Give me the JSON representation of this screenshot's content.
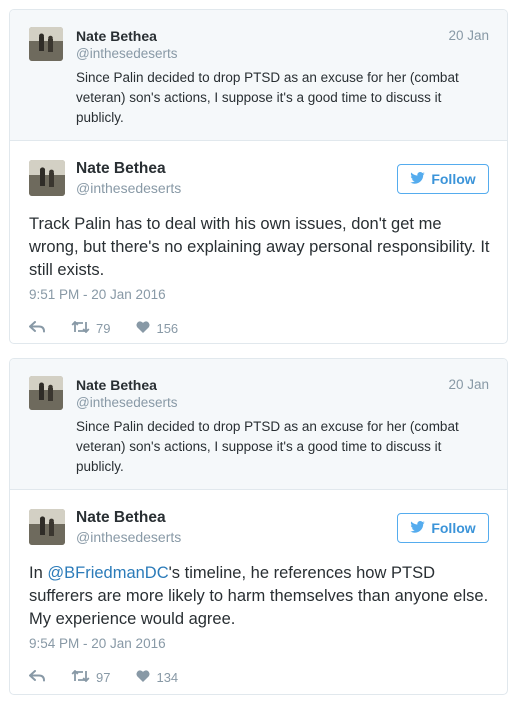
{
  "tweets": [
    {
      "quoted": {
        "name": "Nate Bethea",
        "handle": "@inthesedeserts",
        "date": "20 Jan",
        "text": "Since Palin decided to drop PTSD as an excuse for her (combat veteran) son's actions, I suppose it's a good time to discuss it publicly."
      },
      "main": {
        "name": "Nate Bethea",
        "handle": "@inthesedeserts",
        "follow_label": "Follow",
        "text": "Track Palin has to deal with his own issues, don't get me wrong, but there's no explaining away personal responsibility. It still exists.",
        "timestamp": "9:51 PM - 20 Jan 2016",
        "retweets": "79",
        "likes": "156"
      }
    },
    {
      "quoted": {
        "name": "Nate Bethea",
        "handle": "@inthesedeserts",
        "date": "20 Jan",
        "text": "Since Palin decided to drop PTSD as an excuse for her (combat veteran) son's actions, I suppose it's a good time to discuss it publicly."
      },
      "main": {
        "name": "Nate Bethea",
        "handle": "@inthesedeserts",
        "follow_label": "Follow",
        "text_prefix": "In ",
        "mention": "@BFriedmanDC",
        "text_suffix": "'s timeline, he references how PTSD sufferers are more likely to harm themselves than anyone else. My experience would agree.",
        "timestamp": "9:54 PM - 20 Jan 2016",
        "retweets": "97",
        "likes": "134"
      }
    }
  ],
  "icons": {
    "reply": "reply-icon",
    "retweet": "retweet-icon",
    "like": "heart-icon",
    "follow": "twitter-bird-icon",
    "avatar": "avatar-photo"
  },
  "colors": {
    "link": "#2b7bb9",
    "follow_border": "#55acee",
    "muted": "#8899a6",
    "quoted_bg": "#f5f8fa"
  }
}
